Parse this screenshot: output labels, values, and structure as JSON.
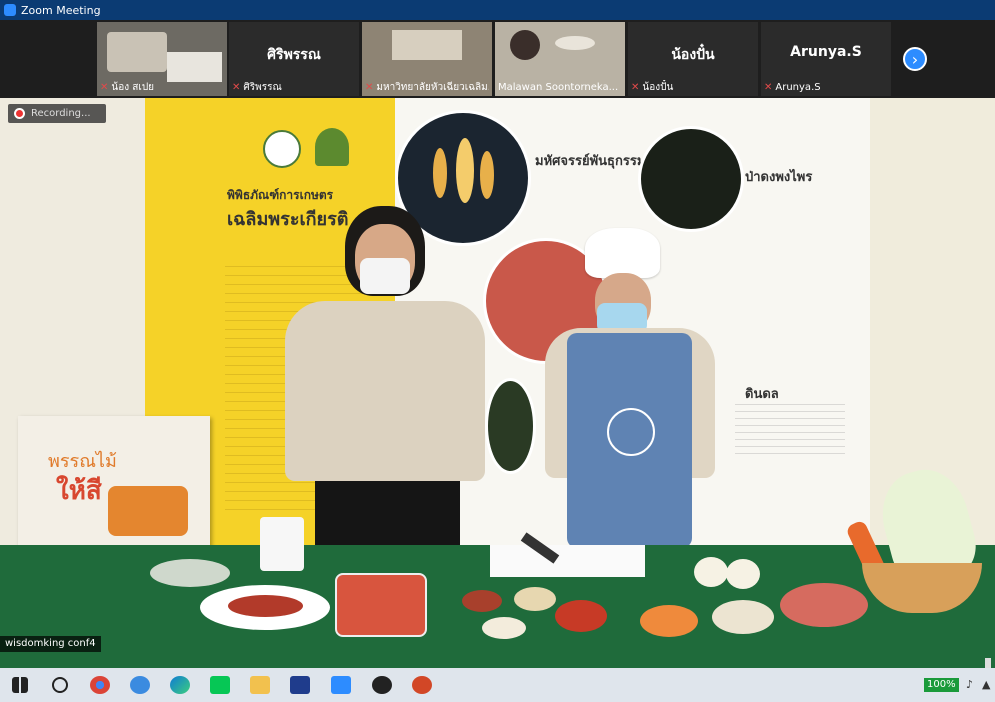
{
  "window": {
    "title": "Zoom Meeting"
  },
  "participants": [
    {
      "name": "น้อง สเปย",
      "kind": "video"
    },
    {
      "name": "ศิริพรรณ",
      "big": "ศิริพรรณ",
      "kind": "name"
    },
    {
      "name": "มหาวิทยาลัยหัวเฉียวเฉลิม...",
      "kind": "video"
    },
    {
      "name": "Malawan Soontorneka...",
      "kind": "video"
    },
    {
      "name": "น้องปั๋น",
      "big": "น้องปั๋น",
      "kind": "name"
    },
    {
      "name": "Arunya.S",
      "big": "Arunya.S",
      "kind": "name"
    }
  ],
  "recording": {
    "label": "Recording..."
  },
  "speaker_video": {
    "name_label": "wisdomking conf4"
  },
  "scene": {
    "banner_title_line1": "พิพิธภัณฑ์การเกษตร",
    "banner_title_line2": "เฉลิมพระเกียรติ",
    "exhibit1": "มหัศจรรย์พันธุกรรม",
    "exhibit2": "ป่าดงพงไพร",
    "exhibit3": "ดินดล",
    "book_line1": "พรรณไม้",
    "book_line2": "ให้สี"
  },
  "taskbar": {
    "battery": "100%"
  },
  "colors": {
    "zoom_blue": "#2d8cff",
    "title_bar": "#0b3b73",
    "mute_red": "#e24a4a"
  }
}
